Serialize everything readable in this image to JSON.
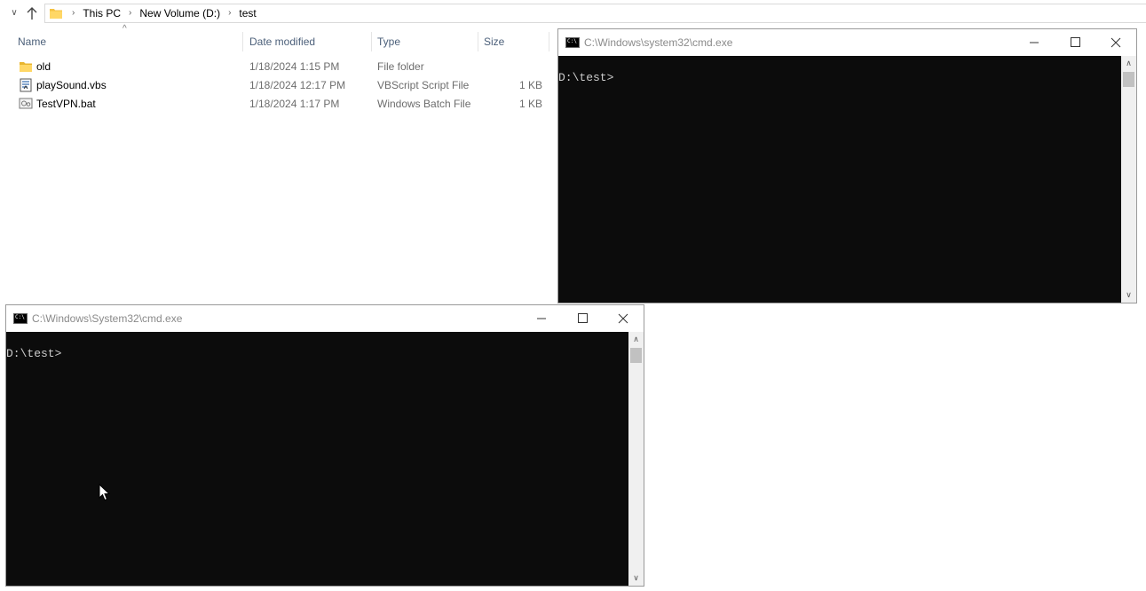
{
  "explorer": {
    "breadcrumb": [
      "This PC",
      "New Volume (D:)",
      "test"
    ],
    "columns": {
      "name": "Name",
      "date_modified": "Date modified",
      "type": "Type",
      "size": "Size"
    },
    "files": [
      {
        "name": "old",
        "date": "1/18/2024 1:15 PM",
        "type": "File folder",
        "size": "",
        "icon": "folder-icon"
      },
      {
        "name": "playSound.vbs",
        "date": "1/18/2024 12:17 PM",
        "type": "VBScript Script File",
        "size": "1 KB",
        "icon": "vbscript-file-icon"
      },
      {
        "name": "TestVPN.bat",
        "date": "1/18/2024 1:17 PM",
        "type": "Windows Batch File",
        "size": "1 KB",
        "icon": "batch-file-icon"
      }
    ]
  },
  "cmd_window_1": {
    "title": "C:\\Windows\\system32\\cmd.exe",
    "prompt": "D:\\test>"
  },
  "cmd_window_2": {
    "title": "C:\\Windows\\System32\\cmd.exe",
    "prompt": "D:\\test>"
  },
  "colors": {
    "console_bg": "#0c0c0c",
    "console_text": "#cccccc",
    "header_text": "#4c607a",
    "folder_yellow": "#f5c242"
  }
}
